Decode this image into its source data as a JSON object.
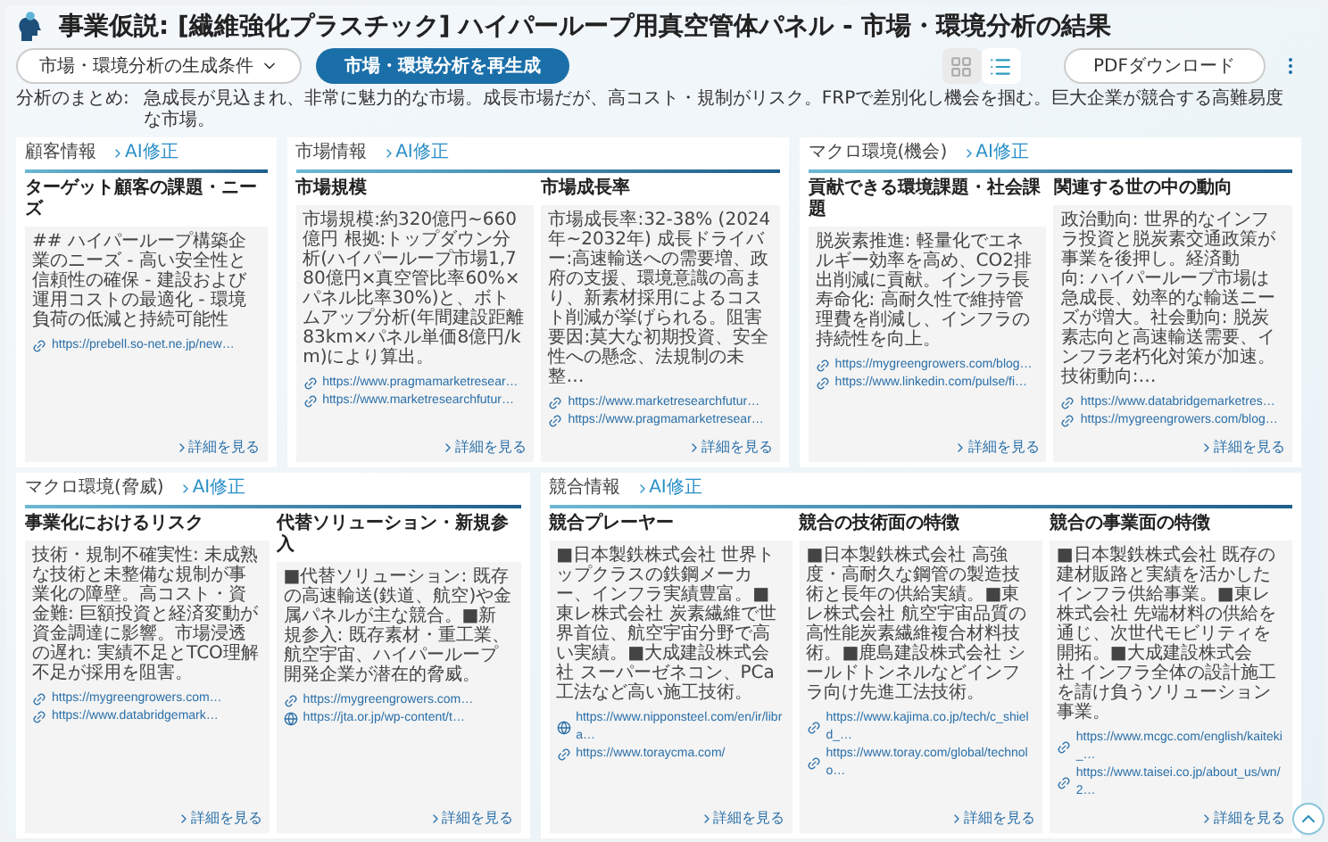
{
  "header": {
    "title": "事業仮説: [繊維強化プラスチック] ハイパーループ用真空管体パネル - 市場・環境分析の結果",
    "conditions_dropdown": "市場・環境分析の生成条件",
    "regenerate_button": "市場・環境分析を再生成",
    "view_toggle": [
      {
        "kind": "grid",
        "selected": false
      },
      {
        "kind": "list",
        "selected": true
      }
    ],
    "pdf_button": "PDFダウンロード"
  },
  "summary": {
    "label": "分析のまとめ:",
    "text": "急成長が見込まれ、非常に魅力的な市場。成長市場だが、高コスト・規制がリスク。FRPで差別化し機会を掴む。巨大企業が競合する高難易度な市場。"
  },
  "rows": [
    {
      "sections": [
        {
          "label": "顧客情報",
          "action": "AI修正",
          "cards": [
            {
              "title": "ターゲット顧客の課題・ニーズ",
              "text": "## ハイパーループ構築企業のニーズ - 高い安全性と信頼性の確保 - 建設および運用コストの最適化 - 環境負荷の低減と持続可能性",
              "links": [
                {
                  "kind": "link",
                  "url": "https://prebell.so-net.ne.jp/new…"
                }
              ],
              "more": "詳細を見る"
            }
          ]
        },
        {
          "label": "市場情報",
          "action": "AI修正",
          "cards": [
            {
              "title": "市場規模",
              "text": "市場規模:約320億円~660億円 根拠:トップダウン分析(ハイパーループ市場1,780億円×真空管比率60%×パネル比率30%)と、ボトムアップ分析(年間建設距離83km×パネル単価8億円/km)により算出。",
              "links": [
                {
                  "kind": "link",
                  "url": "https://www.pragmamarketresear…"
                },
                {
                  "kind": "link",
                  "url": "https://www.marketresearchfutur…"
                }
              ],
              "more": "詳細を見る"
            },
            {
              "title": "市場成長率",
              "text": "市場成長率:32-38% (2024年~2032年) 成長ドライバー:高速輸送への需要増、政府の支援、環境意識の高まり、新素材採用によるコスト削減が挙げられる。阻害要因:莫大な初期投資、安全性への懸念、法規制の未整…",
              "links": [
                {
                  "kind": "link",
                  "url": "https://www.marketresearchfutur…"
                },
                {
                  "kind": "link",
                  "url": "https://www.pragmamarketresear…"
                }
              ],
              "more": "詳細を見る"
            }
          ]
        },
        {
          "label": "マクロ環境(機会)",
          "action": "AI修正",
          "cards": [
            {
              "title": "貢献できる環境課題・社会課題",
              "text": "脱炭素推進: 軽量化でエネルギー効率を高め、CO2排出削減に貢献。インフラ長寿命化: 高耐久性で維持管理費を削減し、インフラの持続性を向上。",
              "links": [
                {
                  "kind": "link",
                  "url": "https://mygreengrowers.com/blog…"
                },
                {
                  "kind": "link",
                  "url": "https://www.linkedin.com/pulse/fi…"
                }
              ],
              "more": "詳細を見る"
            },
            {
              "title": "関連する世の中の動向",
              "text": "政治動向: 世界的なインフラ投資と脱炭素交通政策が事業を後押し。経済動向: ハイパーループ市場は急成長、効率的な輸送ニーズが増大。社会動向: 脱炭素志向と高速輸送需要、インフラ老朽化対策が加速。技術動向:…",
              "links": [
                {
                  "kind": "link",
                  "url": "https://www.databridgemarketres…"
                },
                {
                  "kind": "link",
                  "url": "https://mygreengrowers.com/blog…"
                }
              ],
              "more": "詳細を見る"
            }
          ]
        }
      ]
    },
    {
      "sections": [
        {
          "label": "マクロ環境(脅威)",
          "action": "AI修正",
          "cards": [
            {
              "title": "事業化におけるリスク",
              "text": "技術・規制不確実性: 未成熟な技術と未整備な規制が事業化の障壁。高コスト・資金難: 巨額投資と経済変動が資金調達に影響。市場浸透の遅れ: 実績不足とTCO理解不足が採用を阻害。",
              "links": [
                {
                  "kind": "link",
                  "url": "https://mygreengrowers.com…"
                },
                {
                  "kind": "link",
                  "url": "https://www.databridgemark…"
                }
              ],
              "more": "詳細を見る"
            },
            {
              "title": "代替ソリューション・新規参入",
              "text": "■代替ソリューション: 既存の高速輸送(鉄道、航空)や金属パネルが主な競合。■新規参入: 既存素材・重工業、航空宇宙、ハイパーループ開発企業が潜在的脅威。",
              "links": [
                {
                  "kind": "link",
                  "url": "https://mygreengrowers.com…"
                },
                {
                  "kind": "site",
                  "url": "https://jta.or.jp/wp-content/t…"
                }
              ],
              "more": "詳細を見る"
            }
          ]
        },
        {
          "label": "競合情報",
          "action": "AI修正",
          "cards": [
            {
              "title": "競合プレーヤー",
              "text": "■日本製鉄株式会社 世界トップクラスの鉄鋼メーカー、インフラ実績豊富。■東レ株式会社 炭素繊維で世界首位、航空宇宙分野で高い実績。■大成建設株式会社 スーパーゼネコン、PCa工法など高い施工技術。",
              "links": [
                {
                  "kind": "site",
                  "url": "https://www.nipponsteel.com/en/ir/libra…"
                },
                {
                  "kind": "link",
                  "url": "https://www.toraycma.com/"
                }
              ],
              "more": "詳細を見る"
            },
            {
              "title": "競合の技術面の特徴",
              "text": "■日本製鉄株式会社 高強度・高耐久な鋼管の製造技術と長年の供給実績。■東レ株式会社 航空宇宙品質の高性能炭素繊維複合材料技術。■鹿島建設株式会社 シールドトンネルなどインフラ向け先進工法技術。",
              "links": [
                {
                  "kind": "link",
                  "url": "https://www.kajima.co.jp/tech/c_shield_…"
                },
                {
                  "kind": "link",
                  "url": "https://www.toray.com/global/technolo…"
                }
              ],
              "more": "詳細を見る"
            },
            {
              "title": "競合の事業面の特徴",
              "text": "■日本製鉄株式会社 既存の建材販路と実績を活かしたインフラ供給事業。■東レ株式会社 先端材料の供給を通じ、次世代モビリティを開拓。■大成建設株式会社 インフラ全体の設計施工を請け負うソリューション事業。",
              "links": [
                {
                  "kind": "link",
                  "url": "https://www.mcgc.com/english/kaiteki_…"
                },
                {
                  "kind": "link",
                  "url": "https://www.taisei.co.jp/about_us/wn/2…"
                }
              ],
              "more": "詳細を見る"
            }
          ]
        }
      ]
    }
  ]
}
